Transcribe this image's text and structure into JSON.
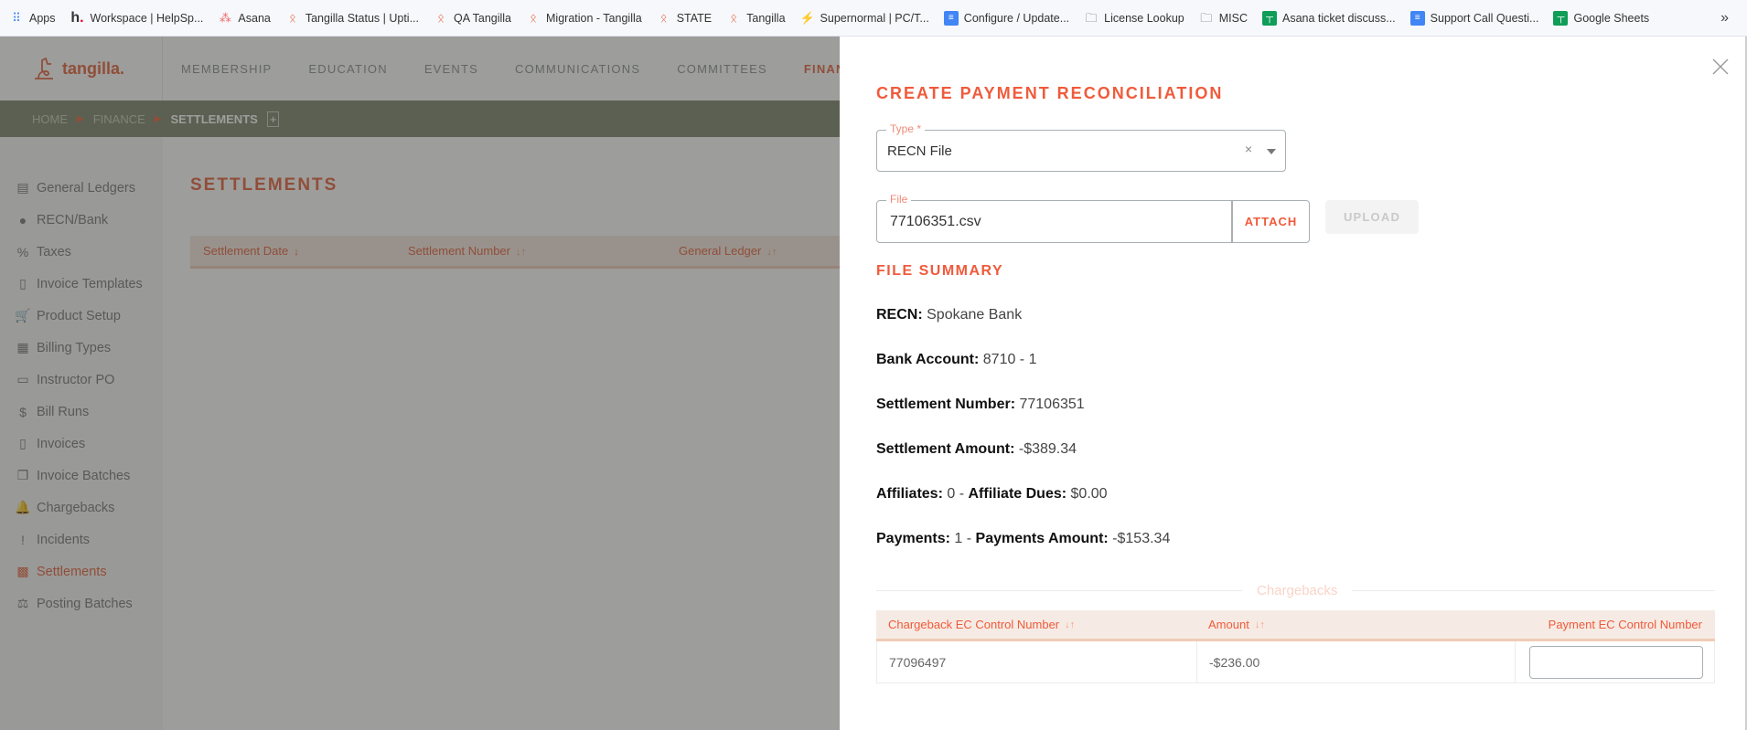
{
  "bookmarks": [
    {
      "label": "Apps",
      "icon": "apps-grid-icon"
    },
    {
      "label": "Workspace | HelpSp...",
      "icon": "helpscout-icon"
    },
    {
      "label": "Asana",
      "icon": "asana-icon"
    },
    {
      "label": "Tangilla Status | Upti...",
      "icon": "tangilla-icon"
    },
    {
      "label": "QA Tangilla",
      "icon": "tangilla-icon"
    },
    {
      "label": "Migration - Tangilla",
      "icon": "tangilla-icon"
    },
    {
      "label": "STATE",
      "icon": "tangilla-icon"
    },
    {
      "label": "Tangilla",
      "icon": "tangilla-icon"
    },
    {
      "label": "Supernormal | PC/T...",
      "icon": "supernormal-icon"
    },
    {
      "label": "Configure / Update...",
      "icon": "google-docs-icon"
    },
    {
      "label": "License Lookup",
      "icon": "folder-icon"
    },
    {
      "label": "MISC",
      "icon": "folder-icon"
    },
    {
      "label": "Asana ticket discuss...",
      "icon": "google-sheets-icon"
    },
    {
      "label": "Support Call Questi...",
      "icon": "google-docs-icon"
    },
    {
      "label": "Google Sheets",
      "icon": "google-sheets-icon"
    }
  ],
  "bookmarks_more": "»",
  "app": {
    "logo_text": "tangilla.",
    "nav": [
      "MEMBERSHIP",
      "EDUCATION",
      "EVENTS",
      "COMMUNICATIONS",
      "COMMITTEES",
      "FINANCE"
    ],
    "nav_active": "FINANCE",
    "breadcrumb": [
      "HOME",
      "FINANCE",
      "SETTLEMENTS"
    ],
    "sidebar": [
      {
        "label": "General Ledgers",
        "icon": "book-icon"
      },
      {
        "label": "RECN/Bank",
        "icon": "piggy-bank-icon"
      },
      {
        "label": "Taxes",
        "icon": "percent-badge-icon"
      },
      {
        "label": "Invoice Templates",
        "icon": "invoice-file-icon"
      },
      {
        "label": "Product Setup",
        "icon": "cart-icon"
      },
      {
        "label": "Billing Types",
        "icon": "calendar-star-icon"
      },
      {
        "label": "Instructor PO",
        "icon": "card-icon"
      },
      {
        "label": "Bill Runs",
        "icon": "dollar-badge-icon"
      },
      {
        "label": "Invoices",
        "icon": "invoice-file-icon"
      },
      {
        "label": "Invoice Batches",
        "icon": "copy-files-icon"
      },
      {
        "label": "Chargebacks",
        "icon": "bell-icon"
      },
      {
        "label": "Incidents",
        "icon": "alert-circle-icon"
      },
      {
        "label": "Settlements",
        "icon": "cash-register-icon",
        "active": true
      },
      {
        "label": "Posting Batches",
        "icon": "scales-icon"
      }
    ],
    "page_title": "SETTLEMENTS",
    "table_headers": [
      "Settlement Date",
      "Settlement Number",
      "General Ledger"
    ]
  },
  "drawer": {
    "title": "CREATE PAYMENT RECONCILIATION",
    "type_label": "Type *",
    "type_value": "RECN File",
    "file_label": "File",
    "file_value": "77106351.csv",
    "attach_label": "ATTACH",
    "upload_label": "UPLOAD",
    "summary_title": "FILE SUMMARY",
    "summary": {
      "recn_label": "RECN:",
      "recn_value": "Spokane Bank",
      "bank_label": "Bank Account:",
      "bank_value": "8710 - 1",
      "settle_num_label": "Settlement Number:",
      "settle_num_value": "77106351",
      "settle_amt_label": "Settlement Amount:",
      "settle_amt_value": "-$389.34",
      "affiliates_label": "Affiliates:",
      "affiliates_value": "0",
      "affiliate_dues_label": "Affiliate Dues:",
      "affiliate_dues_value": "$0.00",
      "payments_label": "Payments:",
      "payments_value": "1",
      "payments_amt_label": "Payments Amount:",
      "payments_amt_value": "-$153.34",
      "separator": "-"
    },
    "chargebacks_label": "Chargebacks",
    "chargebacks_headers": [
      "Chargeback EC Control Number",
      "Amount",
      "Payment EC Control Number"
    ],
    "chargebacks_rows": [
      {
        "control_number": "77096497",
        "amount": "-$236.00",
        "payment_ec_control_number": ""
      }
    ]
  },
  "colors": {
    "accent": "#f05a3b",
    "header_bg": "#f6ebe4"
  }
}
